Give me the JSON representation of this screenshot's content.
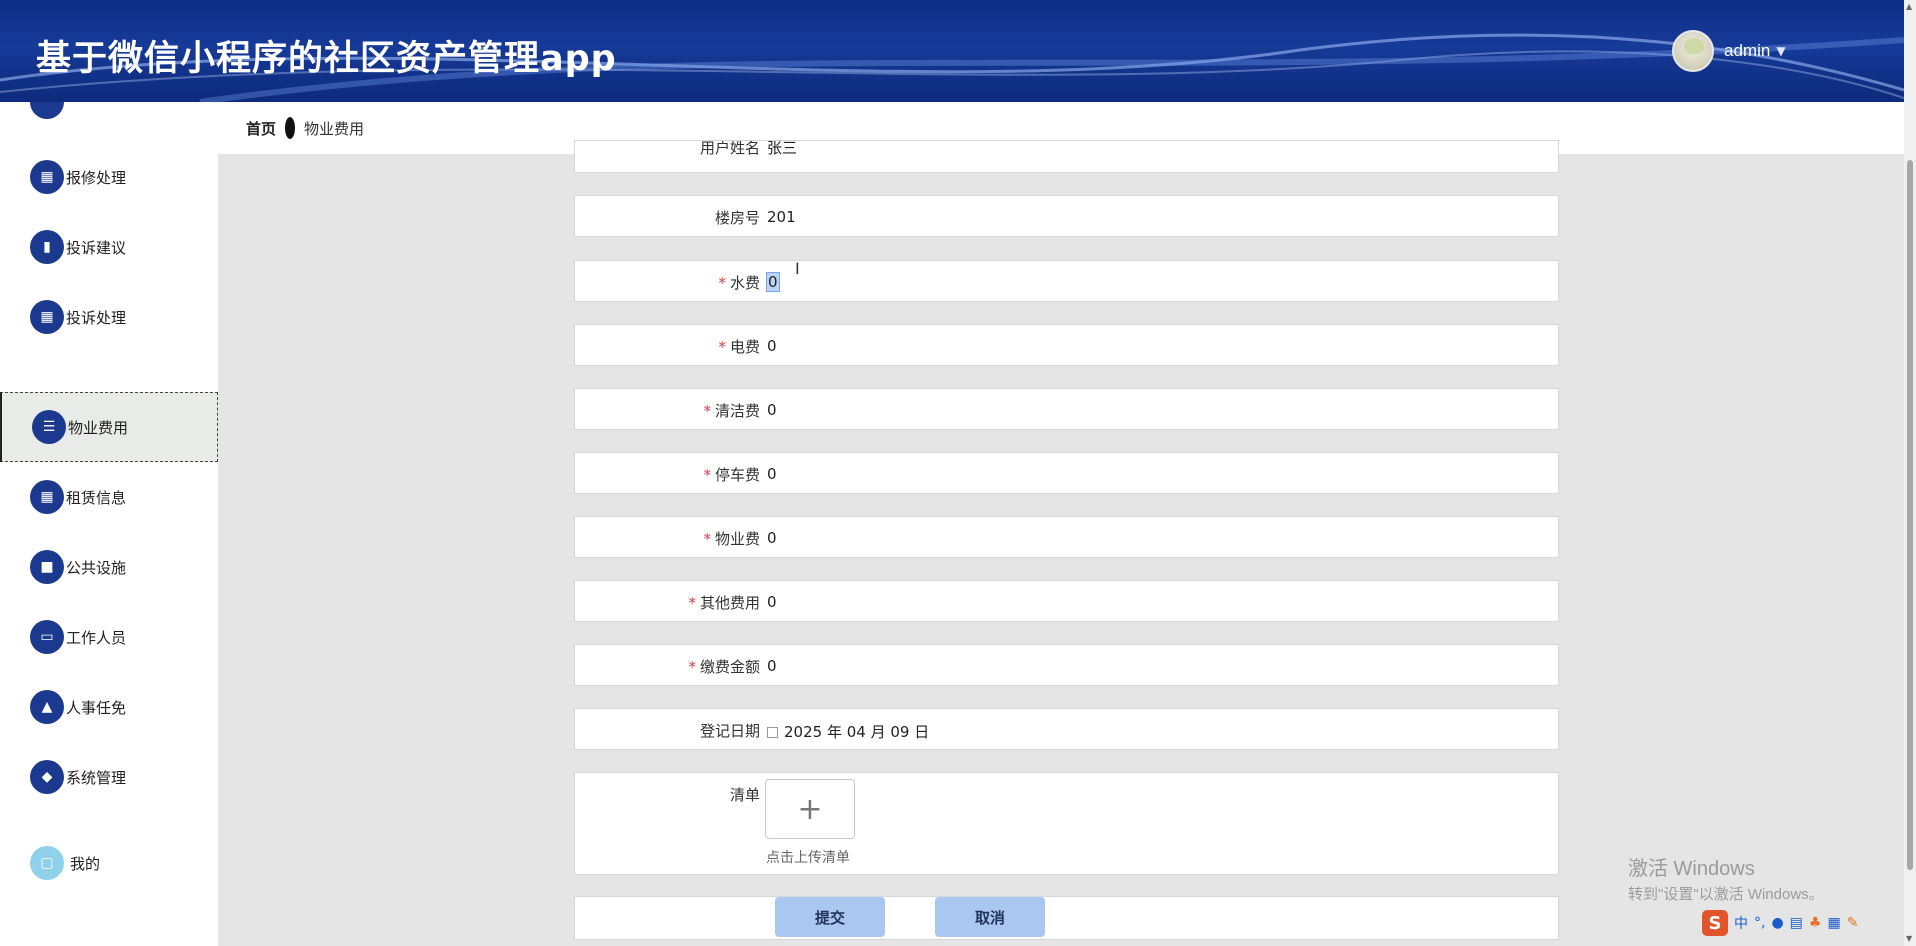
{
  "header": {
    "title": "基于微信小程序的社区资产管理app",
    "username": "admin"
  },
  "breadcrumb": {
    "home": "首页",
    "current": "物业费用"
  },
  "sidebar": {
    "items": [
      {
        "label": "报修处理",
        "icon": "grid-icon"
      },
      {
        "label": "投诉建议",
        "icon": "bar-chart-icon"
      },
      {
        "label": "投诉处理",
        "icon": "grid-icon"
      },
      {
        "label": "物业费用",
        "icon": "menu-lines-icon",
        "active": true
      },
      {
        "label": "租赁信息",
        "icon": "grid-icon"
      },
      {
        "label": "公共设施",
        "icon": "briefcase-icon"
      },
      {
        "label": "工作人员",
        "icon": "monitor-icon"
      },
      {
        "label": "人事任免",
        "icon": "user-stamp-icon"
      },
      {
        "label": "系统管理",
        "icon": "wallet-icon"
      },
      {
        "label": "我的",
        "icon": "card-icon"
      }
    ]
  },
  "form": {
    "top_partial": {
      "label": "用户姓名",
      "value": "张三"
    },
    "building": {
      "label": "楼房号",
      "value": "201"
    },
    "water": {
      "label": "水费",
      "value": "0"
    },
    "electric": {
      "label": "电费",
      "value": "0"
    },
    "cleaning": {
      "label": "清洁费",
      "value": "0"
    },
    "parking": {
      "label": "停车费",
      "value": "0"
    },
    "property": {
      "label": "物业费",
      "value": "0"
    },
    "other": {
      "label": "其他费用",
      "value": "0"
    },
    "payment": {
      "label": "缴费金额",
      "value": "0"
    },
    "reg_date": {
      "label": "登记日期",
      "value": "2025 年 04 月 09 日"
    },
    "list": {
      "label": "清单",
      "upload_hint": "点击上传清单"
    },
    "required_mark": "*",
    "submit_label": "提交",
    "cancel_label": "取消"
  },
  "watermark": {
    "line1": "激活 Windows",
    "line2": "转到\"设置\"以激活 Windows。"
  },
  "ime": {
    "logo": "S",
    "lang": "中"
  }
}
